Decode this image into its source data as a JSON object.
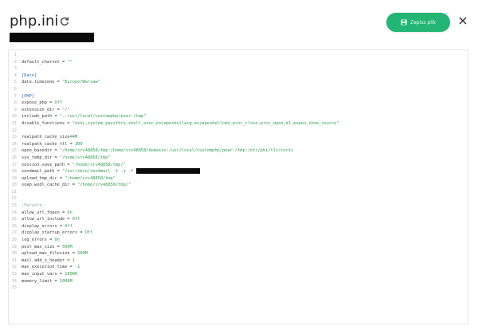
{
  "header": {
    "title": "php.ini",
    "save_label": "Zapisz plik"
  },
  "colors": {
    "accent": "#22b573",
    "string": "#2f9c4e",
    "section": "#2a6fb2"
  },
  "editor": {
    "lines": [
      {
        "n": "1",
        "parts": []
      },
      {
        "n": "2",
        "parts": [
          {
            "t": "default_charset = ",
            "c": "k"
          },
          {
            "t": "\"\"",
            "c": "s"
          }
        ]
      },
      {
        "n": "3",
        "parts": []
      },
      {
        "n": "4",
        "parts": [
          {
            "t": "[Date]",
            "c": "sec"
          }
        ]
      },
      {
        "n": "5",
        "parts": [
          {
            "t": "date.timezone = ",
            "c": "k"
          },
          {
            "t": "\"Europe/Warsaw\"",
            "c": "s"
          }
        ]
      },
      {
        "n": "6",
        "parts": []
      },
      {
        "n": "7",
        "parts": [
          {
            "t": "[PHP]",
            "c": "sec"
          }
        ]
      },
      {
        "n": "8",
        "parts": [
          {
            "t": "expose_php = ",
            "c": "k"
          },
          {
            "t": "Off",
            "c": "n"
          }
        ]
      },
      {
        "n": "9",
        "parts": [
          {
            "t": "extension_dir = ",
            "c": "k"
          },
          {
            "t": "\"/\"",
            "c": "s"
          }
        ]
      },
      {
        "n": "10",
        "parts": [
          {
            "t": "include_path = ",
            "c": "k"
          },
          {
            "t": "\".:/usr/local/customphp/pear:/tmp\"",
            "c": "s"
          }
        ]
      },
      {
        "n": "11",
        "parts": [
          {
            "t": "disable_functions = ",
            "c": "k"
          },
          {
            "t": "\"exec,system,passthru,shell_exec,escapeshellarg,escapeshellcmd,proc_close,proc_open,dl,popen,show_source\"",
            "c": "s"
          }
        ]
      },
      {
        "n": "12",
        "parts": []
      },
      {
        "n": "13",
        "parts": [
          {
            "t": "realpath_cache_size=",
            "c": "k"
          },
          {
            "t": "4M",
            "c": "n"
          }
        ]
      },
      {
        "n": "14",
        "parts": [
          {
            "t": "realpath_cache_ttl = ",
            "c": "k"
          },
          {
            "t": "300",
            "c": "n"
          }
        ]
      },
      {
        "n": "15",
        "parts": [
          {
            "t": "open_basedir = ",
            "c": "k"
          },
          {
            "t": "\"/home/srv48858/tmp:/home/srv48858/domains:/usr/local/customphp/pear:/tmp:/etc/pki/tls/certs",
            "c": "s"
          }
        ]
      },
      {
        "n": "16",
        "parts": [
          {
            "t": "sys_temp_dir = ",
            "c": "k"
          },
          {
            "t": "\"/home/srv48858/tmp\"",
            "c": "s"
          }
        ]
      },
      {
        "n": "17",
        "parts": [
          {
            "t": "session.save_path = ",
            "c": "k"
          },
          {
            "t": "\"/home/srv48858/tmp/\"",
            "c": "s"
          }
        ]
      },
      {
        "n": "18",
        "parts": [
          {
            "t": "sendmail_path = ",
            "c": "k"
          },
          {
            "t": "\"/usr/sbin/sendmail -t -i -f ",
            "c": "s"
          },
          {
            "redact": true
          }
        ]
      },
      {
        "n": "19",
        "parts": [
          {
            "t": "upload_tmp_dir = ",
            "c": "k"
          },
          {
            "t": "\"/home/srv48858/tmp\"",
            "c": "s"
          }
        ]
      },
      {
        "n": "20",
        "parts": [
          {
            "t": "soap.wsdl_cache_dir = ",
            "c": "k"
          },
          {
            "t": "\"/home/srv48858/tmp/\"",
            "c": "s"
          }
        ]
      },
      {
        "n": "21",
        "parts": []
      },
      {
        "n": "22",
        "parts": []
      },
      {
        "n": "23",
        "parts": [
          {
            "t": ";Parsers;",
            "c": "cm"
          }
        ]
      },
      {
        "n": "24",
        "parts": [
          {
            "t": "allow_url_fopen = ",
            "c": "k"
          },
          {
            "t": "On",
            "c": "n"
          }
        ]
      },
      {
        "n": "25",
        "parts": [
          {
            "t": "allow_url_include = ",
            "c": "k"
          },
          {
            "t": "Off",
            "c": "n"
          }
        ]
      },
      {
        "n": "26",
        "parts": [
          {
            "t": "display_errors = ",
            "c": "k"
          },
          {
            "t": "Off",
            "c": "n"
          }
        ]
      },
      {
        "n": "27",
        "parts": [
          {
            "t": "display_startup_errors = ",
            "c": "k"
          },
          {
            "t": "Off",
            "c": "n"
          }
        ]
      },
      {
        "n": "28",
        "parts": [
          {
            "t": "log_errors = ",
            "c": "k"
          },
          {
            "t": "On",
            "c": "n"
          }
        ]
      },
      {
        "n": "29",
        "parts": [
          {
            "t": "post_max_size = ",
            "c": "k"
          },
          {
            "t": "500M",
            "c": "n"
          }
        ]
      },
      {
        "n": "30",
        "parts": [
          {
            "t": "upload_max_filesize = ",
            "c": "k"
          },
          {
            "t": "500M",
            "c": "n"
          }
        ]
      },
      {
        "n": "31",
        "parts": [
          {
            "t": "mail.add_x_header = ",
            "c": "k"
          },
          {
            "t": "1",
            "c": "n"
          }
        ]
      },
      {
        "n": "32",
        "parts": [
          {
            "t": "max_execution_time = ",
            "c": "k"
          },
          {
            "t": "-1",
            "c": "n"
          }
        ]
      },
      {
        "n": "33",
        "parts": [
          {
            "t": "max_input_vars = ",
            "c": "k"
          },
          {
            "t": "10000",
            "c": "n"
          }
        ]
      },
      {
        "n": "34",
        "parts": [
          {
            "t": "memory_limit = ",
            "c": "k"
          },
          {
            "t": "1000M",
            "c": "n"
          }
        ]
      },
      {
        "n": "35",
        "parts": []
      }
    ]
  }
}
